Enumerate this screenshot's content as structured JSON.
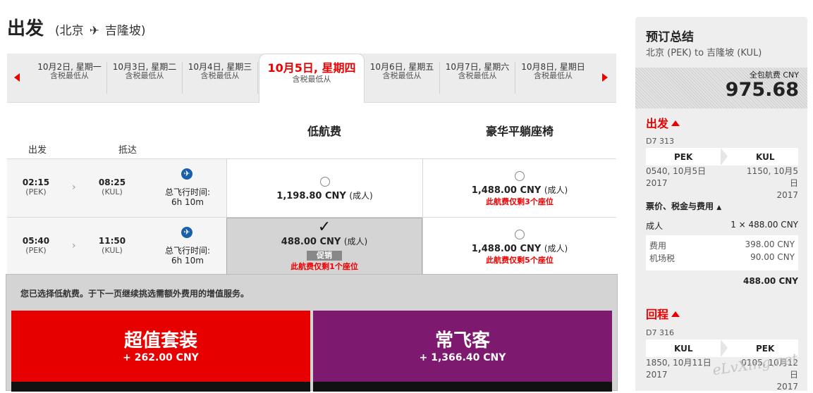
{
  "header": {
    "title": "出发",
    "origin": "(北京",
    "plane": "✈",
    "destination": "吉隆坡)"
  },
  "dates": [
    {
      "date": "10月2日, 星期一",
      "sub": "含税最低从"
    },
    {
      "date": "10月3日, 星期二",
      "sub": "含税最低从"
    },
    {
      "date": "10月4日, 星期三",
      "sub": "含税最低从"
    },
    {
      "date": "10月5日, 星期四",
      "sub": "含税最低从"
    },
    {
      "date": "10月6日, 星期五",
      "sub": "含税最低从"
    },
    {
      "date": "10月7日, 星期六",
      "sub": "含税最低从"
    },
    {
      "date": "10月8日, 星期日",
      "sub": "含税最低从"
    }
  ],
  "columns": {
    "low": "低航费",
    "premium": "豪华平躺座椅",
    "depart": "出发",
    "arrive": "抵达"
  },
  "flights": [
    {
      "dep_time": "02:15",
      "dep_code": "(PEK)",
      "arr_time": "08:25",
      "arr_code": "(KUL)",
      "duration_label": "总飞行时间:",
      "duration": "6h 10m",
      "low_price": "1,198.80 CNY",
      "low_unit": "(成人)",
      "low_warn": "",
      "promo": "",
      "prem_price": "1,488.00 CNY",
      "prem_unit": "(成人)",
      "prem_warn": "此航费仅剩3个座位"
    },
    {
      "dep_time": "05:40",
      "dep_code": "(PEK)",
      "arr_time": "11:50",
      "arr_code": "(KUL)",
      "duration_label": "总飞行时间:",
      "duration": "6h 10m",
      "low_price": "488.00 CNY",
      "low_unit": "(成人)",
      "low_warn": "此航费仅剩1个座位",
      "promo": "促销",
      "prem_price": "1,488.00 CNY",
      "prem_unit": "(成人)",
      "prem_warn": "此航费仅剩5个座位"
    }
  ],
  "selection": {
    "message": "您已选择低航费。于下一页继续挑选需额外费用的增值服务。",
    "pkg1": {
      "name": "超值套装",
      "price": "+ 262.00 CNY",
      "color": "#e60000"
    },
    "pkg2": {
      "name": "常飞客",
      "price": "+ 1,366.40 CNY",
      "color": "#7d1a6f"
    }
  },
  "summary": {
    "title": "预订总结",
    "route": "北京 (PEK) to 吉隆坡 (KUL)",
    "total_label": "全包航费 CNY",
    "total": "975.68",
    "out": {
      "label": "出发",
      "flight": "D7 313",
      "from": "PEK",
      "to": "KUL",
      "dep": "0540, 10月5日",
      "dep_year": "2017",
      "arr": "1150, 10月5日",
      "arr_year": "2017"
    },
    "fares_label": "票价、税金与费用",
    "adult": "成人",
    "adult_calc": "1 × 488.00 CNY",
    "fee_label": "费用",
    "fee": "398.00 CNY",
    "tax_label": "机场税",
    "tax": "90.00 CNY",
    "subtotal": "488.00 CNY",
    "ret": {
      "label": "回程",
      "flight": "D7 316",
      "from": "KUL",
      "to": "PEK",
      "dep": "1850, 10月11日",
      "dep_year": "2017",
      "arr": "0105, 10月12日",
      "arr_year": "2017"
    }
  },
  "watermark": "eLvXing.net",
  "colors": {
    "accent": "#e00000",
    "brand_purple": "#7d1a6f"
  }
}
